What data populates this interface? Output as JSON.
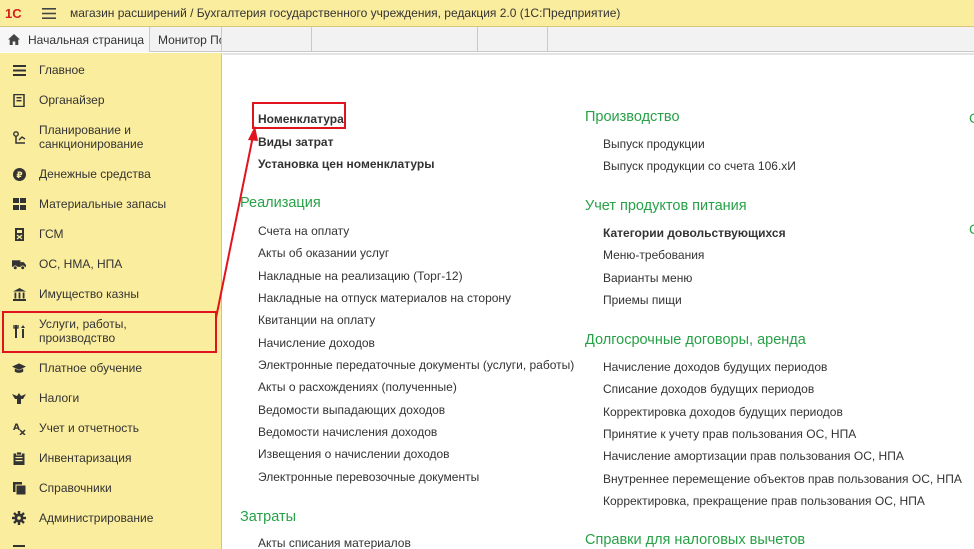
{
  "titlebar": {
    "logo": "1С",
    "title": "магазин расширений / Бухгалтерия государственного учреждения, редакция 2.0  (1С:Предприятие)",
    "icons": [
      "1c-logo-icon",
      "hamburger-menu-icon"
    ]
  },
  "tabs": {
    "home_label": "Начальная страница",
    "monitor_label": "Монитор По"
  },
  "sidebar": {
    "items": [
      {
        "label": "Главное",
        "icon": "hamburger-menu-icon"
      },
      {
        "label": "Органайзер",
        "icon": "notebook-icon"
      },
      {
        "label": "Планирование и\nсанкционирование",
        "icon": "planning-icon"
      },
      {
        "label": "Денежные средства",
        "icon": "ruble-coin-icon"
      },
      {
        "label": "Материальные запасы",
        "icon": "grid-icon"
      },
      {
        "label": "ГСМ",
        "icon": "fuel-icon"
      },
      {
        "label": "ОС, НМА, НПА",
        "icon": "truck-icon"
      },
      {
        "label": "Имущество казны",
        "icon": "building-icon"
      },
      {
        "label": "Услуги, работы,\nпроизводство",
        "icon": "tools-icon"
      },
      {
        "label": "Платное обучение",
        "icon": "graduation-cap-icon"
      },
      {
        "label": "Налоги",
        "icon": "eagle-icon"
      },
      {
        "label": "Учет и отчетность",
        "icon": "accounting-icon"
      },
      {
        "label": "Инвентаризация",
        "icon": "clipboard-icon"
      },
      {
        "label": "Справочники",
        "icon": "books-icon"
      },
      {
        "label": "Администрирование",
        "icon": "gear-icon"
      }
    ]
  },
  "content": {
    "col1_top": [
      "Номенклатура",
      "Виды затрат",
      "Установка цен номенклатуры"
    ],
    "realization": {
      "title": "Реализация",
      "items": [
        "Счета на оплату",
        "Акты об оказании услуг",
        "Накладные на реализацию (Торг-12)",
        "Накладные на отпуск материалов на сторону",
        "Квитанции на оплату",
        "Начисление доходов",
        "Электронные передаточные документы (услуги, работы)",
        "Акты о расхождениях (полученные)",
        "Ведомости выпадающих доходов",
        "Ведомости начисления доходов",
        "Извещения о начислении доходов",
        "Электронные перевозочные документы"
      ]
    },
    "costs": {
      "title": "Затраты",
      "items": [
        "Акты списания материалов"
      ]
    },
    "production": {
      "title": "Производство",
      "items": [
        "Выпуск продукции",
        "Выпуск продукции со счета 106.хИ"
      ]
    },
    "food": {
      "title": "Учет продуктов питания",
      "items": [
        "Категории довольствующихся",
        "Меню-требования",
        "Варианты меню",
        "Приемы пищи"
      ]
    },
    "longterm": {
      "title": "Долгосрочные договоры, аренда",
      "items": [
        "Начисление доходов будущих периодов",
        "Списание доходов будущих периодов",
        "Корректировка доходов будущих периодов",
        "Принятие к учету прав пользования ОС, НПА",
        "Начисление амортизации прав пользования ОС, НПА",
        "Внутреннее перемещение объектов прав пользования ОС, НПА",
        "Корректировка, прекращение прав пользования ОС, НПА"
      ]
    },
    "tax": {
      "title": "Справки для налоговых вычетов"
    },
    "edge_mark": "С"
  },
  "colors": {
    "sidebar_bg": "#fbed9e",
    "section_green": "#27a147",
    "annotation_red": "#e0141e"
  }
}
